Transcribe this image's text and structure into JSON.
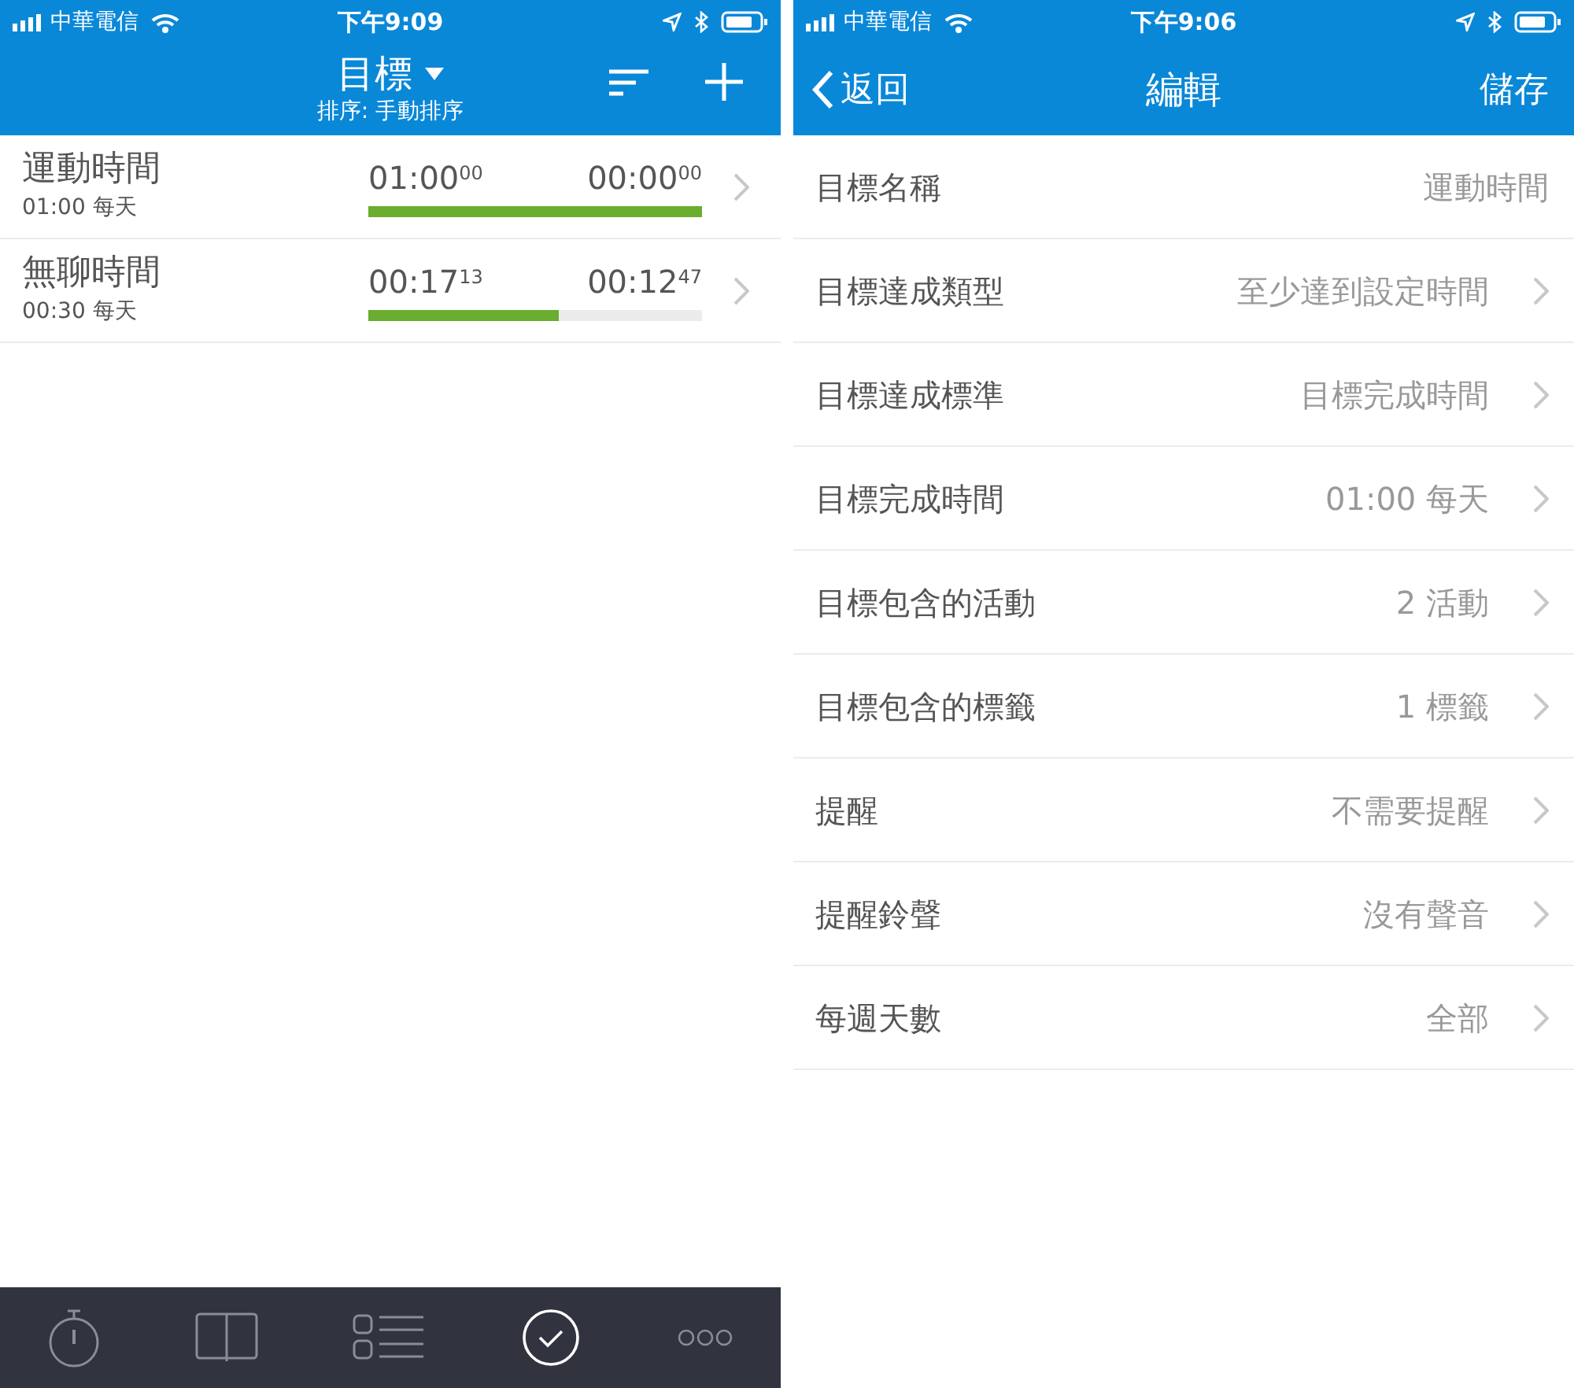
{
  "left": {
    "status_bar": {
      "carrier": "中華電信",
      "time": "下午9:09"
    },
    "header": {
      "title": "目標",
      "subtitle": "排序: 手動排序"
    },
    "goals": [
      {
        "name": "運動時間",
        "schedule": "01:00 每天",
        "elapsed": "01:00$^{00}$",
        "remaining": "00:00$^{00}$",
        "level": 1.0
      },
      {
        "name": "無聊時間",
        "schedule": "00:30 每天",
        "elapsed": "00:17$^{13}$",
        "remaining": "00:12$^{47}$",
        "level": 0.57
      }
    ],
    "tab_bar": [
      {
        "kind": "stopwatch",
        "selected": false
      },
      {
        "kind": "book",
        "selected": false
      },
      {
        "kind": "list",
        "selected": false
      },
      {
        "kind": "goal",
        "selected": true
      },
      {
        "kind": "more",
        "selected": false
      }
    ]
  },
  "right": {
    "status_bar": {
      "carrier": "中華電信",
      "time": "下午9:06"
    },
    "nav": {
      "back": "返回",
      "title": "編輯",
      "save": "儲存"
    },
    "fields": [
      {
        "label": "目標名稱",
        "value": "運動時間",
        "disclosure": false
      },
      {
        "label": "目標達成類型",
        "value": "至少達到設定時間",
        "disclosure": true
      },
      {
        "label": "目標達成標準",
        "value": "目標完成時間",
        "disclosure": true
      },
      {
        "label": "目標完成時間",
        "value": "01:00 每天",
        "disclosure": true
      },
      {
        "label": "目標包含的活動",
        "value": "2 活動",
        "disclosure": true
      },
      {
        "label": "目標包含的標籤",
        "value": "1 標籤",
        "disclosure": true
      },
      {
        "label": "提醒",
        "value": "不需要提醒",
        "disclosure": true
      },
      {
        "label": "提醒鈴聲",
        "value": "沒有聲音",
        "disclosure": true
      },
      {
        "label": "每週天數",
        "value": "全部",
        "disclosure": true
      }
    ]
  }
}
